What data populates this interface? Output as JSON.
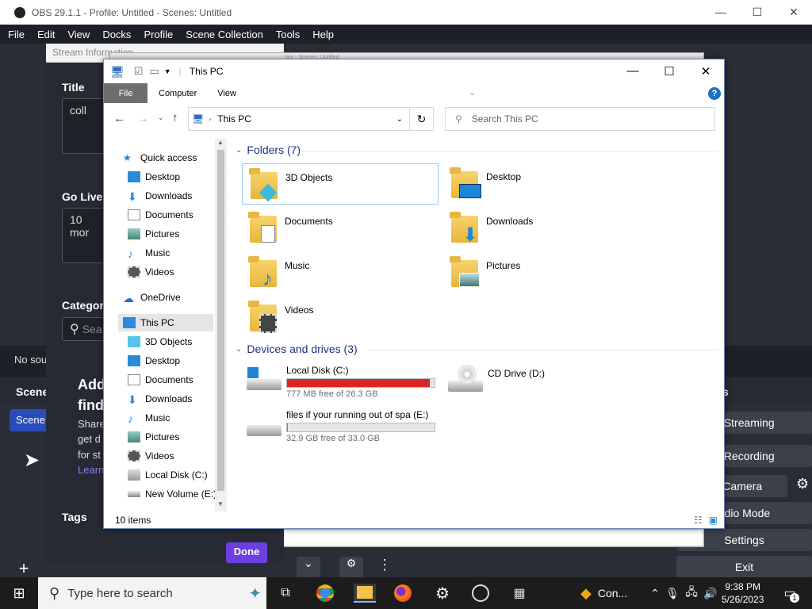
{
  "obs": {
    "title": "OBS 29.1.1 - Profile: Untitled - Scenes: Untitled",
    "menu": [
      "File",
      "Edit",
      "View",
      "Docks",
      "Profile",
      "Scene Collection",
      "Tools",
      "Help"
    ],
    "no_source": "No sou",
    "scenes_header": "Scene",
    "scene_item": "Scene",
    "add_title_1": "Add",
    "add_title_2": "find",
    "add_text_1": "Share",
    "add_text_2": "get d",
    "add_text_3": "for st",
    "learn": "Learn",
    "controls": [
      "rt Streaming",
      "rt Recording",
      "tual Camera",
      "udio Mode",
      "Settings",
      "Exit"
    ],
    "controls_header": "s"
  },
  "stream_info": {
    "title": "Stream Information",
    "bg_title": "ries - Scenes: Untitled",
    "title_label": "Title",
    "title_value": "coll",
    "golive_label": "Go Live",
    "golive_value": "10 mor",
    "category_label": "Categor",
    "category_placeholder": "Sea",
    "tags_label": "Tags",
    "done": "Done"
  },
  "explorer": {
    "title": "This PC",
    "ribbon": {
      "file": "File",
      "computer": "Computer",
      "view": "View"
    },
    "address": "This PC",
    "search_placeholder": "Search This PC",
    "nav": {
      "quick_access": "Quick access",
      "desktop": "Desktop",
      "downloads": "Downloads",
      "documents": "Documents",
      "pictures": "Pictures",
      "music": "Music",
      "videos": "Videos",
      "onedrive": "OneDrive",
      "this_pc": "This PC",
      "objects3d": "3D Objects",
      "pc_desktop": "Desktop",
      "pc_documents": "Documents",
      "pc_downloads": "Downloads",
      "pc_music": "Music",
      "pc_pictures": "Pictures",
      "pc_videos": "Videos",
      "local_disk": "Local Disk (C:)",
      "new_volume": "New Volume (E:)"
    },
    "folders_header": "Folders (7)",
    "folders": [
      "3D Objects",
      "Desktop",
      "Documents",
      "Downloads",
      "Music",
      "Pictures",
      "Videos"
    ],
    "devices_header": "Devices and drives (3)",
    "drives": [
      {
        "name": "Local Disk (C:)",
        "free": "777 MB free of 26.3 GB",
        "used_fraction": 0.97,
        "color": "#da2626"
      },
      {
        "name": "CD Drive (D:)"
      },
      {
        "name": "files if your running out of spa (E:)",
        "free": "32.9 GB free of 33.0 GB",
        "used_fraction": 0.003,
        "color": "#26a0da"
      }
    ],
    "status": "10 items"
  },
  "taskbar": {
    "search_placeholder": "Type here to search",
    "app_label": "Con...",
    "time": "9:38 PM",
    "date": "5/26/2023",
    "notif_count": "1"
  }
}
